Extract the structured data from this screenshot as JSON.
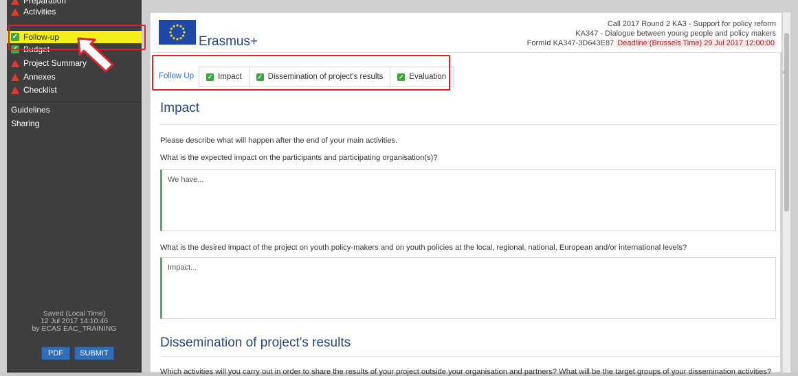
{
  "sidebar": {
    "items": [
      {
        "label": "Preparation",
        "status": "warning"
      },
      {
        "label": "Activities",
        "status": "warning"
      },
      {
        "label": "Follow-up",
        "status": "ok"
      },
      {
        "label": "Budget",
        "status": "ok"
      },
      {
        "label": "Project Summary",
        "status": "warning"
      },
      {
        "label": "Annexes",
        "status": "warning"
      },
      {
        "label": "Checklist",
        "status": "warning"
      }
    ],
    "links": [
      "Guidelines",
      "Sharing"
    ],
    "saved": {
      "line1": "Saved (Local Time)",
      "line2": "12 Jul 2017 14:10:46",
      "line3": "by ECAS EAC_TRAINING"
    },
    "buttons": {
      "pdf": "PDF",
      "submit": "SUBMIT"
    }
  },
  "header": {
    "brand": "Erasmus+",
    "line1": "Call 2017  Round 2  KA3 - Support for policy reform",
    "line2": "KA347 - Dialogue between young people and policy makers",
    "formid": "FormId KA347-3D643E87",
    "deadline": "Deadline (Brussels Time) 29 Jul 2017 12:00:00"
  },
  "tabs": {
    "first": "Follow Up",
    "items": [
      "Impact",
      "Dissemination of project's results",
      "Evaluation"
    ]
  },
  "impact": {
    "title": "Impact",
    "intro": "Please describe what will happen after the end of your main activities.",
    "q1": "What is the expected impact on the participants and participating organisation(s)?",
    "a1": "We have...",
    "q2": "What is the desired impact of the project on youth policy-makers and on youth policies at the local, regional, national, European and/or international levels?",
    "a2": "Impact..."
  },
  "dissemination": {
    "title": "Dissemination of project's results",
    "q1": "Which activities will you carry out in order to share the results of your project outside your organisation and partners? What will be the target groups of your dissemination activities?"
  },
  "colors": {
    "sidebar_bg": "#3e3e3e",
    "highlight": "#f4ee1a",
    "accent_blue": "#26447d",
    "ok_green": "#3aa63c",
    "warn_red": "#e03a2f",
    "annotation_red": "#d8242a"
  }
}
